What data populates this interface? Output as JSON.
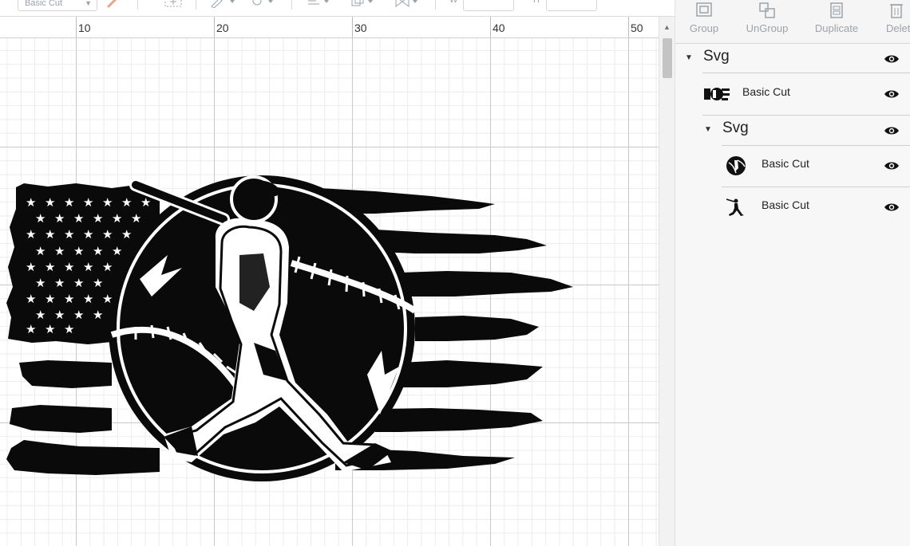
{
  "toolbar": {
    "operation_select": "Basic Cut",
    "width_label": "W",
    "height_label": "H"
  },
  "ruler": {
    "labels": [
      "10",
      "20",
      "30",
      "40",
      "50"
    ]
  },
  "panel": {
    "actions": [
      {
        "label": "Group",
        "icon": "group-icon"
      },
      {
        "label": "UnGroup",
        "icon": "ungroup-icon"
      },
      {
        "label": "Duplicate",
        "icon": "duplicate-icon"
      },
      {
        "label": "Delete",
        "icon": "delete-icon"
      }
    ],
    "layers": [
      {
        "name": "Svg",
        "type": "group",
        "level": 0,
        "thumb": null
      },
      {
        "name": "Basic Cut",
        "type": "layer",
        "level": 1,
        "thumb": "flag-thumbnail"
      },
      {
        "name": "Svg",
        "type": "group",
        "level": 1,
        "thumb": null
      },
      {
        "name": "Basic Cut",
        "type": "layer",
        "level": 2,
        "thumb": "baseball-thumbnail"
      },
      {
        "name": "Basic Cut",
        "type": "layer",
        "level": 2,
        "thumb": "batter-thumbnail"
      }
    ]
  },
  "canvas": {
    "artwork": "distressed-flag-baseball-batter-design"
  },
  "colors": {
    "ink": "#0a0a0a",
    "panel_bg": "#f7f7f7",
    "disabled_text": "#9da3a9"
  }
}
